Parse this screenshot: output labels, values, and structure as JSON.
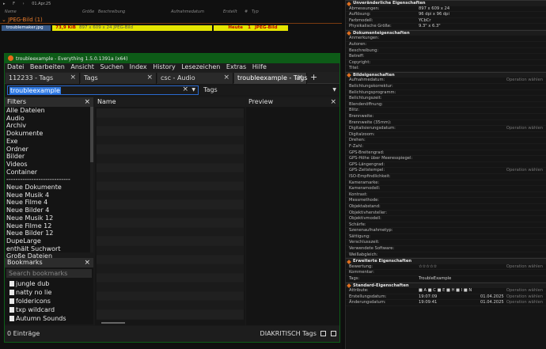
{
  "explorer": {
    "topbar": [
      "▸",
      "F",
      "›",
      "01.Apr.25"
    ],
    "columns": [
      "Name",
      "Größe",
      "Beschreibung",
      "Aufnahmedatum",
      "Erstellt",
      "#",
      "Typ"
    ],
    "group_title": "JPEG-Bild (1)",
    "file": {
      "name": "troublemaker.jpg",
      "size": "73,9 KiB",
      "description": "897 x 609 x 24 JPEG-Bild",
      "date": "Heute",
      "number": "1",
      "type": "JPEG-Bild"
    }
  },
  "everything": {
    "title": "troubleexample - Everything 1.5.0.1391a (x64)",
    "menu": [
      "Datei",
      "Bearbeiten",
      "Ansicht",
      "Suchen",
      "Index",
      "History",
      "Lesezeichen",
      "Extras",
      "Hilfe"
    ],
    "tabs": [
      "112233 - Tags",
      "Tags",
      "csc - Audio",
      "troubleexample - Tags"
    ],
    "search": {
      "query": "troubleexample",
      "filter": "Tags"
    },
    "filters_title": "Filters",
    "filters": [
      "Alle Dateien",
      "Audio",
      "Archiv",
      "Dokumente",
      "Exe",
      "Ordner",
      "Bilder",
      "Videos",
      "Container",
      "----------------------------",
      "Neue Dokumente",
      "Neue Musik 4",
      "Neue Filme 4",
      "Neue Bilder 4",
      "Neue Musik 12",
      "Neue Filme 12",
      "Neue Bilder 12",
      "DupeLarge",
      "enthält Suchwort",
      "Große Dateien"
    ],
    "bookmarks_title": "Bookmarks",
    "bookmarks_placeholder": "Search bookmarks",
    "bookmarks": [
      "jungle dub",
      "natty no lie",
      "foldericons",
      "txp wildcard",
      "Autumn Sounds"
    ],
    "results_header": "Name",
    "preview_header": "Preview",
    "status": {
      "count": "0 Einträge",
      "mode": "DIAKRITISCH",
      "tags": "Tags"
    }
  },
  "props": {
    "sections": [
      {
        "title": "Unveränderliche Eigenschaften",
        "rows": [
          {
            "label": "Abmessungen:",
            "value": "897 x 609 x 24"
          },
          {
            "label": "Auflösung:",
            "value": "96 dpi x 96 dpi"
          },
          {
            "label": "Farbmodell:",
            "value": "YCbCr"
          },
          {
            "label": "Physikalische Größe:",
            "value": "9.3\" x 6.3\""
          }
        ]
      },
      {
        "title": "Dokumenteigenschaften",
        "rows": [
          {
            "label": "Anmerkungen:"
          },
          {
            "label": "Autoren:"
          },
          {
            "label": "Beschreibung:"
          },
          {
            "label": "Betreff:"
          },
          {
            "label": "Copyright:"
          },
          {
            "label": "Titel:"
          }
        ]
      },
      {
        "title": "Bildeigenschaften",
        "rows": [
          {
            "label": "Aufnahmedatum:",
            "hint": "Operation wählen"
          },
          {
            "label": "Belichtungskorrektur:"
          },
          {
            "label": "Belichtungsprogramm:"
          },
          {
            "label": "Belichtungszeit:"
          },
          {
            "label": "Blendenöffnung:"
          },
          {
            "label": "Blitz:"
          },
          {
            "label": "Brennweite:"
          },
          {
            "label": "Brennweite (35mm):"
          },
          {
            "label": "Digitalisierungsdatum:",
            "hint": "Operation wählen"
          },
          {
            "label": "Digitalzoom:"
          },
          {
            "label": "Drehen:"
          },
          {
            "label": "F-Zahl:"
          },
          {
            "label": "GPS-Breitengrad:"
          },
          {
            "label": "GPS-Höhe über Meeresspiegel:"
          },
          {
            "label": "GPS-Längengrad:"
          },
          {
            "label": "GPS-Zeitstempel:",
            "hint": "Operation wählen"
          },
          {
            "label": "ISO-Empfindlichkeit:"
          },
          {
            "label": "Kameramarke:"
          },
          {
            "label": "Kameramodell:"
          },
          {
            "label": "Kontrast:"
          },
          {
            "label": "Messmethode:"
          },
          {
            "label": "Objektabstand:"
          },
          {
            "label": "Objektivhersteller:"
          },
          {
            "label": "Objektivmodell:"
          },
          {
            "label": "Schärfe:"
          },
          {
            "label": "Szenenaufnahmetyp:"
          },
          {
            "label": "Sättigung:"
          },
          {
            "label": "Verschlusszeit:"
          },
          {
            "label": "Verwendete Software:"
          },
          {
            "label": "Weißabgleich:"
          }
        ]
      },
      {
        "title": "Erweiterte Eigenschaften",
        "rows": [
          {
            "label": "Bewertung:",
            "value": "☆☆☆☆☆",
            "hint": "Operation wählen"
          },
          {
            "label": "Kommentar:"
          },
          {
            "label": "Tags:",
            "value": "TroubleExample"
          }
        ]
      },
      {
        "title": "Standard-Eigenschaften",
        "rows": [
          {
            "label": "Attribute:",
            "value": "■ A ■ C ■ E ■ H ■ I ■ N",
            "hint": "Operation wählen"
          },
          {
            "label": "Erstellungsdatum:",
            "value": "19:07:09",
            "value2": "01.04.2025",
            "hint": "Operation wählen"
          },
          {
            "label": "Änderungsdatum:",
            "value": "19:09:41",
            "value2": "01.04.2025",
            "hint": "Operation wählen"
          }
        ]
      }
    ]
  },
  "colors": {
    "accent": "#e07020",
    "titlebar": "#0d5b17",
    "selection": "#2f7ae5",
    "highlight_row": "#e5e500"
  }
}
